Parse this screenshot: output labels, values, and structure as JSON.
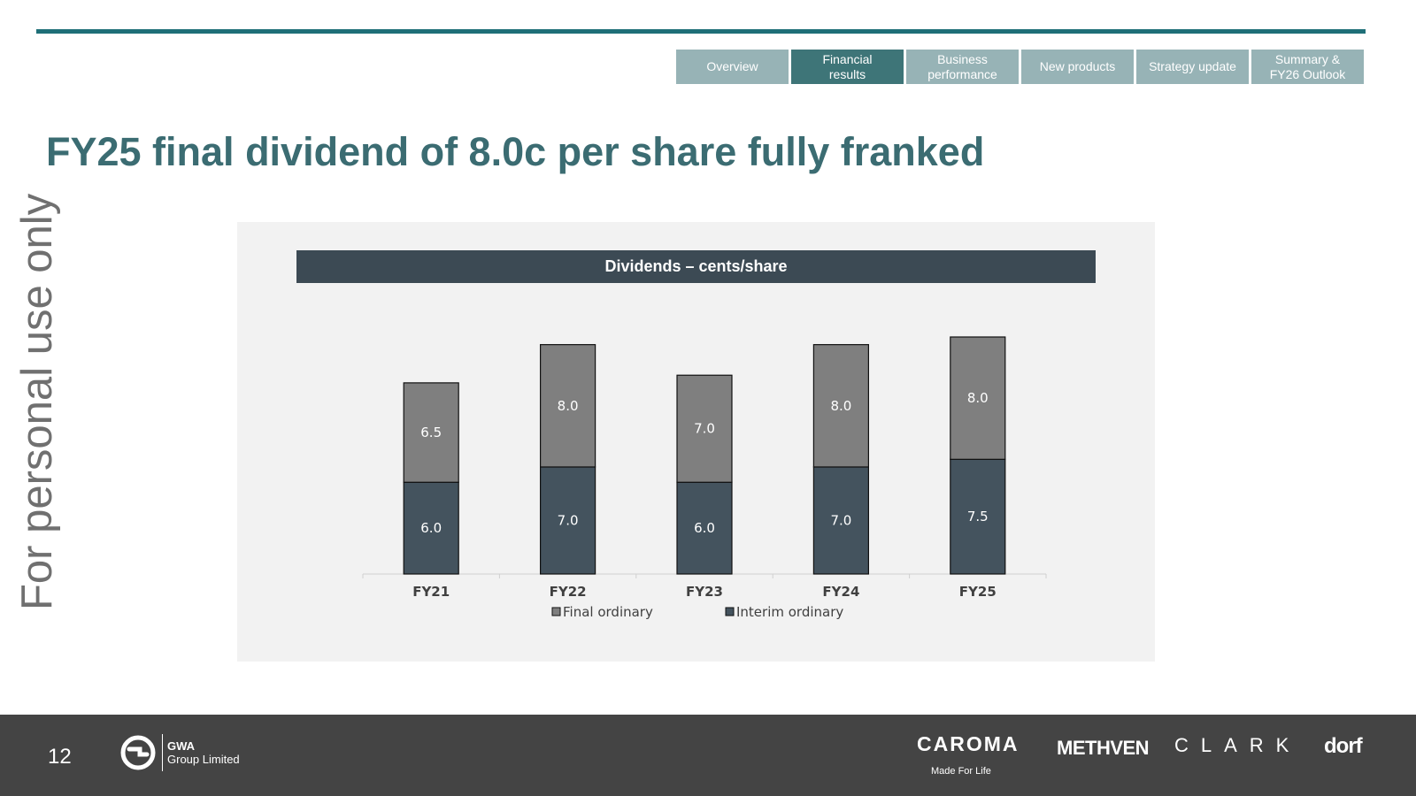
{
  "nav": {
    "tabs": [
      {
        "label": "Overview",
        "active": false
      },
      {
        "label": "Financial\nresults",
        "active": true
      },
      {
        "label": "Business\nperformance",
        "active": false
      },
      {
        "label": "New products",
        "active": false
      },
      {
        "label": "Strategy update",
        "active": false
      },
      {
        "label": "Summary &\nFY26 Outlook",
        "active": false
      }
    ]
  },
  "page_title": "FY25 final dividend of 8.0c per share fully franked",
  "side_watermark": "For personal use only",
  "colors": {
    "accent": "#1f6f78",
    "title": "#3b6c72",
    "final_ordinary": "#7f7f7f",
    "interim_ordinary": "#44535e",
    "chart_title_bar": "#3c4a54",
    "footer": "#444444"
  },
  "chart_data": {
    "type": "bar",
    "stacked": true,
    "title": "Dividends – cents/share",
    "categories": [
      "FY21",
      "FY22",
      "FY23",
      "FY24",
      "FY25"
    ],
    "series": [
      {
        "name": "Interim ordinary",
        "values": [
          6.0,
          7.0,
          6.0,
          7.0,
          7.5
        ],
        "labels": [
          "6.0",
          "7.0",
          "6.0",
          "7.0",
          "7.5"
        ]
      },
      {
        "name": "Final ordinary",
        "values": [
          6.5,
          8.0,
          7.0,
          8.0,
          8.0
        ],
        "labels": [
          "6.5",
          "8.0",
          "7.0",
          "8.0",
          "8.0"
        ]
      }
    ],
    "legend_order": [
      "Final ordinary",
      "Interim ordinary"
    ],
    "legend_position": "bottom",
    "ylim": [
      0,
      15.5
    ],
    "grid": false
  },
  "footer": {
    "page_number": "12",
    "company_name": "GWA",
    "company_suffix": "Group Limited",
    "brands": {
      "caroma": "CAROMA",
      "caroma_tagline": "Made For Life",
      "methven": "METHVEN",
      "clark": "CLARK",
      "dorf": "dorf"
    }
  }
}
